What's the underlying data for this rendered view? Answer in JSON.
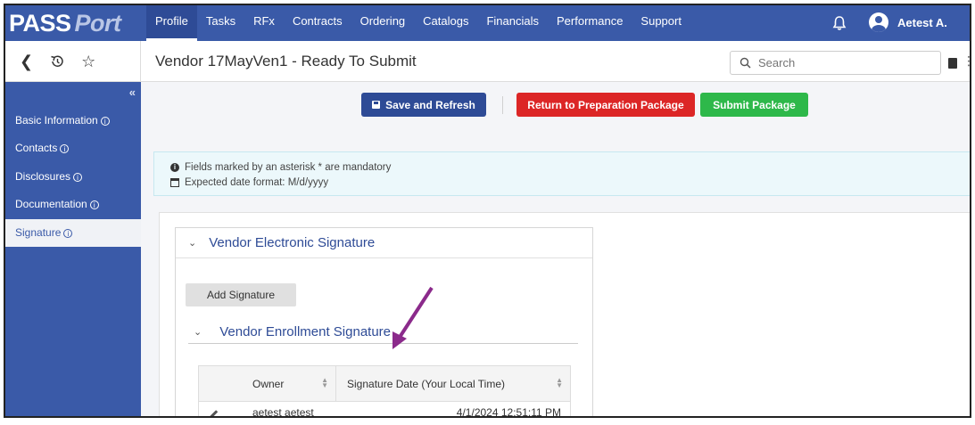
{
  "brand": {
    "pass": "PASS",
    "port": "Port"
  },
  "nav": {
    "items": [
      "Profile",
      "Tasks",
      "RFx",
      "Contracts",
      "Ordering",
      "Catalogs",
      "Financials",
      "Performance",
      "Support"
    ],
    "active": "Profile"
  },
  "user": {
    "name": "Aetest A."
  },
  "page": {
    "title": "Vendor 17MayVen1 - Ready To Submit"
  },
  "search": {
    "placeholder": "Search",
    "value": ""
  },
  "sidebar": {
    "items": [
      {
        "label": "Basic Information",
        "active": false
      },
      {
        "label": "Contacts",
        "active": false
      },
      {
        "label": "Disclosures",
        "active": false
      },
      {
        "label": "Documentation",
        "active": false
      },
      {
        "label": "Signature",
        "active": true
      }
    ]
  },
  "actions": {
    "save": "Save and Refresh",
    "return": "Return to Preparation Package",
    "submit": "Submit Package"
  },
  "notice": {
    "line1": "Fields marked by an asterisk * are mandatory",
    "line2": "Expected date format: M/d/yyyy"
  },
  "signature_section": {
    "title": "Vendor Electronic Signature",
    "add_button": "Add Signature",
    "sub_title": "Vendor Enrollment Signature",
    "columns": [
      "Owner",
      "Signature Date (Your Local Time)"
    ],
    "rows": [
      {
        "owner": "aetest aetest",
        "date": "4/1/2024 12:51:11 PM"
      }
    ]
  },
  "colors": {
    "brand_blue": "#3a5aa8",
    "return_red": "#dc2626",
    "submit_green": "#2eb84a",
    "annotation_arrow": "#8b2a8b"
  }
}
